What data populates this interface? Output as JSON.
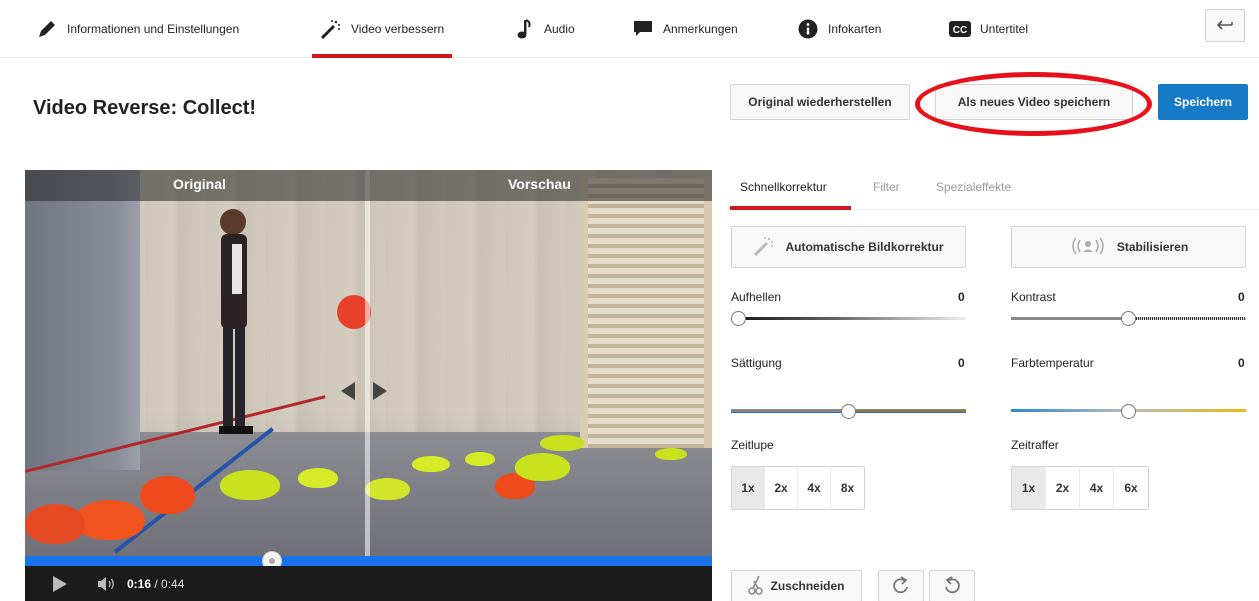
{
  "nav": {
    "items": [
      {
        "label": "Informationen und Einstellungen",
        "icon": "pencil-icon"
      },
      {
        "label": "Video verbessern",
        "icon": "magic-wand-icon",
        "active": true
      },
      {
        "label": "Audio",
        "icon": "music-note-icon"
      },
      {
        "label": "Anmerkungen",
        "icon": "speech-bubble-icon"
      },
      {
        "label": "Infokarten",
        "icon": "info-icon"
      },
      {
        "label": "Untertitel",
        "icon": "cc-icon"
      }
    ],
    "back_icon": "back-arrow-icon"
  },
  "header": {
    "title": "Video Reverse: Collect!",
    "restore_label": "Original wiederherstellen",
    "save_new_label": "Als neues Video speichern",
    "save_label": "Speichern"
  },
  "video": {
    "original_label": "Original",
    "preview_label": "Vorschau",
    "current_time": "0:16",
    "separator": " / ",
    "duration": "0:44",
    "progress_fraction": 0.36
  },
  "panel": {
    "tabs": [
      "Schnellkorrektur",
      "Filter",
      "Spezialeffekte"
    ],
    "auto_fix_label": "Automatische Bildkorrektur",
    "stabilize_label": "Stabilisieren",
    "sliders": {
      "brightness": {
        "label": "Aufhellen",
        "value": "0"
      },
      "contrast": {
        "label": "Kontrast",
        "value": "0"
      },
      "saturation": {
        "label": "Sättigung",
        "value": "0"
      },
      "temperature": {
        "label": "Farbtemperatur",
        "value": "0"
      }
    },
    "slowmo": {
      "label": "Zeitlupe",
      "options": [
        "1x",
        "2x",
        "4x",
        "8x"
      ],
      "selected": "1x"
    },
    "timelapse": {
      "label": "Zeitraffer",
      "options": [
        "1x",
        "2x",
        "4x",
        "6x"
      ],
      "selected": "1x"
    },
    "trim_label": "Zuschneiden"
  },
  "colors": {
    "accent_red": "#cc181e",
    "primary_blue": "#167ac6",
    "highlight_ring": "#e8101a"
  }
}
